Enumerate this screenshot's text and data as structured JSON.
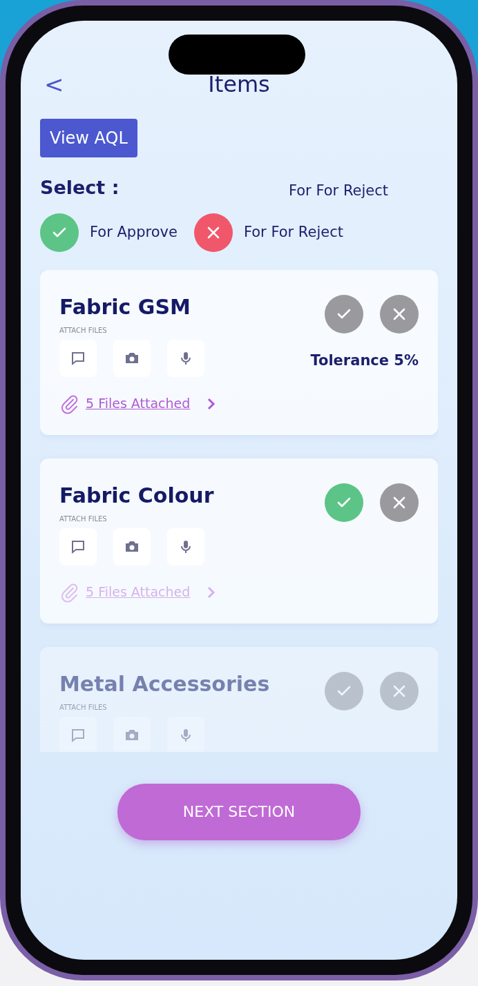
{
  "header": {
    "back": "<",
    "title": "Items"
  },
  "aql_button": "View AQL",
  "select_label": "Select :",
  "legend_note": "For For Reject",
  "legend": [
    {
      "kind": "approve",
      "label": "For Approve",
      "color": "#5cc486"
    },
    {
      "kind": "reject",
      "label": "For For Reject",
      "color": "#f0576a"
    }
  ],
  "items": [
    {
      "title": "Fabric GSM",
      "attach_label": "ATTACH FILES",
      "approved": false,
      "rejected": false,
      "tolerance": "Tolerance 5%",
      "files": "5 Files Attached",
      "faded": false
    },
    {
      "title": "Fabric Colour",
      "attach_label": "ATTACH FILES",
      "approved": true,
      "rejected": false,
      "files": "5 Files Attached",
      "faded": false
    },
    {
      "title": "Metal Accessories",
      "attach_label": "ATTACH FILES",
      "approved": false,
      "rejected": false,
      "faded": true
    }
  ],
  "next_button": "NEXT SECTION"
}
